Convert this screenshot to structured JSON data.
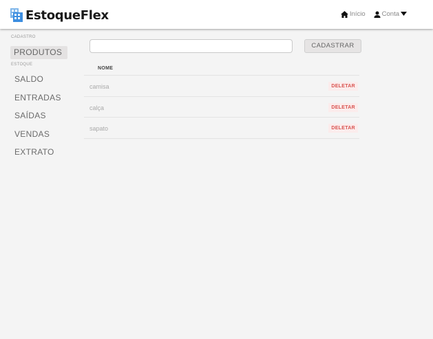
{
  "brand": {
    "name": "EstoqueFlex"
  },
  "topnav": {
    "home_label": "Início",
    "account_label": "Conta"
  },
  "sidebar": {
    "cadastro_label": "CADASTRO",
    "produtos": "PRODUTOS",
    "estoque_label": "ESTOQUE",
    "saldo": "SALDO",
    "entradas": "ENTRADAS",
    "saidas": "SAÍDAS",
    "vendas": "VENDAS",
    "extrato": "EXTRATO"
  },
  "form": {
    "input_value": "",
    "button_label": "CADASTRAR"
  },
  "table": {
    "header": "NOME",
    "delete_label": "DELETAR",
    "rows": [
      "camisa",
      "calça",
      "sapato"
    ]
  },
  "colors": {
    "accent": "#3d8ee0",
    "danger": "#d9534f",
    "background": "#f4f4f4"
  }
}
